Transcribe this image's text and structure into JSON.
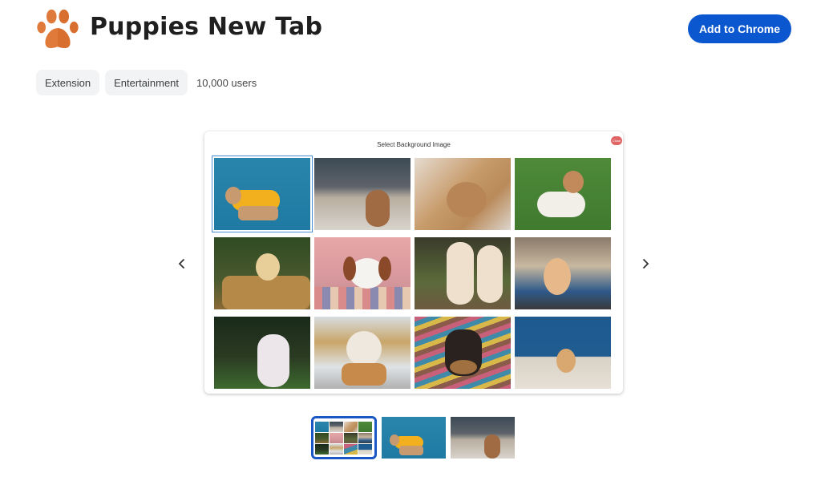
{
  "header": {
    "title": "Puppies New Tab",
    "logo_icon": "paw-icon",
    "add_button_label": "Add to Chrome",
    "brand_color": "#0b57d0",
    "logo_color": "#e07a3a"
  },
  "meta": {
    "chips": [
      "Extension",
      "Entertainment"
    ],
    "users": "10,000 users"
  },
  "carousel": {
    "prev_icon": "chevron-left-icon",
    "next_icon": "chevron-right-icon",
    "current_slide": 1,
    "total_slides": 3,
    "screenshot": {
      "title": "Select Background Image",
      "close_label": "Close",
      "selected_index": 0,
      "images": [
        "French bulldog in yellow sweater on blue background",
        "Poodle puppy running on porch steps",
        "Golden doodle puppy lying on blanket",
        "Jack Russell puppy lying on grass",
        "Golden retriever puppy in wicker basket",
        "Cavalier puppy lying on striped cushion",
        "Two golden retriever puppies on grass",
        "Poodle puppy on blue pillow",
        "White puppy running on grass",
        "Fluffy puppy lying on floor",
        "Yorkie puppy on striped rug",
        "Small poodle puppy by blue wall"
      ]
    },
    "thumbnails": [
      "Select background image grid",
      "French bulldog in yellow sweater",
      "Poodle puppy on porch steps"
    ]
  }
}
